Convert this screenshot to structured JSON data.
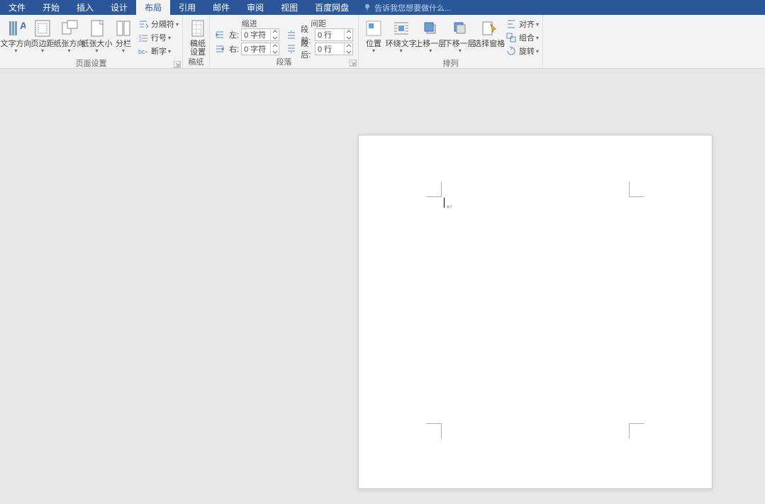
{
  "tabs": {
    "file": "文件",
    "home": "开始",
    "insert": "插入",
    "design": "设计",
    "layout": "布局",
    "references": "引用",
    "mailings": "邮件",
    "review": "审阅",
    "view": "视图",
    "baidu": "百度网盘"
  },
  "tell_me_placeholder": "告诉我您想要做什么...",
  "page_setup": {
    "group_label": "页面设置",
    "text_direction": "文字方向",
    "margins": "页边距",
    "orientation": "纸张方向",
    "size": "纸张大小",
    "columns": "分栏",
    "breaks": "分隔符",
    "line_numbers": "行号",
    "hyphenation": "断字"
  },
  "manuscript": {
    "group_label": "稿纸",
    "button": "稿纸\n设置"
  },
  "paragraph": {
    "group_label": "段落",
    "indent_header": "缩进",
    "spacing_header": "间距",
    "left_label": "左:",
    "right_label": "右:",
    "before_label": "段前:",
    "after_label": "段后:",
    "left_value": "0 字符",
    "right_value": "0 字符",
    "before_value": "0 行",
    "after_value": "0 行"
  },
  "arrange": {
    "group_label": "排列",
    "position": "位置",
    "wrap": "环绕文字",
    "bring_forward": "上移一层",
    "send_backward": "下移一层",
    "selection_pane": "选择窗格",
    "align": "对齐",
    "group": "组合",
    "rotate": "旋转"
  }
}
